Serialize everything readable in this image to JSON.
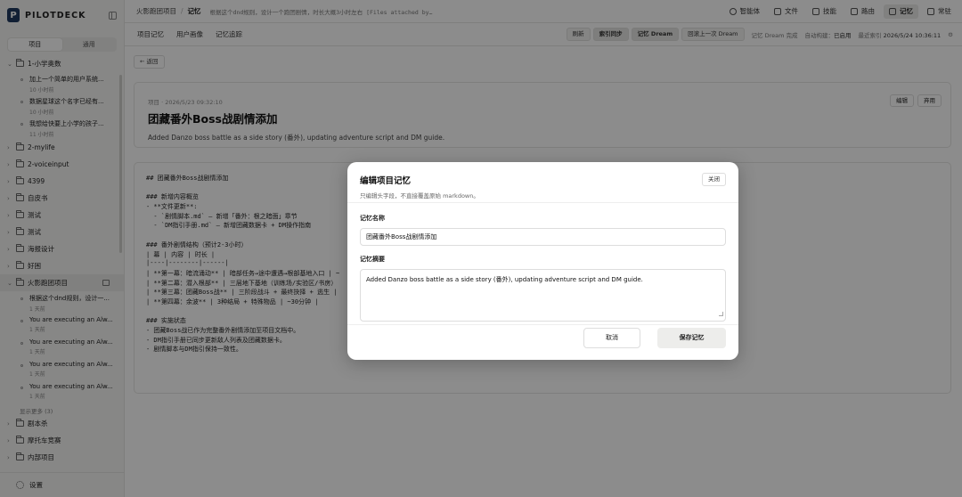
{
  "app": {
    "logo_letter": "P",
    "name": "PILOTDECK"
  },
  "sidebar": {
    "seg_project": "项目",
    "seg_general": "通用",
    "groups": [
      {
        "name": "1-小学奥数",
        "expanded": true,
        "items": [
          {
            "title": "加上一个简单的用户系统...",
            "time": "10 小时前"
          },
          {
            "title": "数据星球这个名字已经有...",
            "time": "10 小时前"
          },
          {
            "title": "我想给快要上小学的孩子...",
            "time": "11 小时前"
          }
        ]
      },
      {
        "name": "2-mylife"
      },
      {
        "name": "2-voiceinput"
      },
      {
        "name": "4399"
      },
      {
        "name": "自皮书"
      },
      {
        "name": "测试"
      },
      {
        "name": "测试"
      },
      {
        "name": "海报设计"
      },
      {
        "name": "好困"
      },
      {
        "name": "火影跑团项目",
        "expanded": true,
        "active": true,
        "items": [
          {
            "title": "根据这个dnd规则，设计一...",
            "time": "1 天前"
          },
          {
            "title": "You are executing an Alw...",
            "time": "1 天前"
          },
          {
            "title": "You are executing an Alw...",
            "time": "1 天前"
          },
          {
            "title": "You are executing an Alw...",
            "time": "1 天前"
          },
          {
            "title": "You are executing an Alw...",
            "time": "1 天前"
          }
        ],
        "more": "显示更多 (3)"
      },
      {
        "name": "剧本杀"
      },
      {
        "name": "摩托车竞赛"
      },
      {
        "name": "内部项目"
      }
    ],
    "settings": "设置"
  },
  "topbar": {
    "crumb_project": "火影跑团项目",
    "crumb_page": "记忆",
    "session": "根据这个dnd规则，设计一个跑团剧情，时长大概3小时左右 [Files attached by u…",
    "nav": [
      {
        "label": "智能体",
        "icon": "agent-icon"
      },
      {
        "label": "文件",
        "icon": "folder-icon"
      },
      {
        "label": "技能",
        "icon": "skill-icon"
      },
      {
        "label": "路由",
        "icon": "route-icon"
      },
      {
        "label": "记忆",
        "icon": "memory-icon",
        "active": true
      },
      {
        "label": "常驻",
        "icon": "resident-icon"
      }
    ]
  },
  "subbar": {
    "tabs": [
      "项目记忆",
      "用户画像",
      "记忆追踪"
    ],
    "refresh": "刷新",
    "index_sync": "索引同步",
    "dream": "记忆 Dream",
    "rollback": "回滚上一次 Dream",
    "dream_status": "记忆 Dream 完成",
    "auto_build_label": "自动构建：",
    "auto_build_value": "已启用",
    "last_index_label": "最近索引",
    "last_index_value": "2026/5/24 10:36:11"
  },
  "back": "← 返回",
  "memory": {
    "date": "项目 · 2026/5/23 09:32:10",
    "title": "团藏番外Boss战剧情添加",
    "summary": "Added Danzo boss battle as a side story (番外), updating adventure script and DM guide.",
    "edit": "编辑",
    "delete": "弃用",
    "content_lines": [
      "## 团藏番外Boss战剧情添加",
      "",
      "### 新增内容概览",
      "- **文件更新**:",
      "  - `剧情脚本.md` — 新增「番外：根之暗面」章节",
      "  - `DM指引手册.md` — 新增团藏数据卡 + DM操作指南",
      "",
      "### 番外剧情结构（预计2-3小时）",
      "| 幕 | 内容 | 时长 |",
      "|----|--------|------|",
      "| **第一幕：暗流涌动** | 暗部任务→途中遭遇→根部基地入口 | ~",
      "| **第二幕：潜入根部** | 三层地下基地（训练场/实验区/书房）",
      "| **第三幕：团藏Boss战** | 三阶段战斗 + 最终抉择 + 逃生 |",
      "| **第四幕：余波** | 3种结局 + 特殊物品 | ~30分钟 |",
      "",
      "### 实施状态",
      "- 团藏Boss战已作为完整番外剧情添加至项目文档中。",
      "- DM指引手册已同步更新敌人列表及团藏数据卡。",
      "- 剧情脚本与DM指引保持一致性。"
    ]
  },
  "modal": {
    "title": "编辑项目记忆",
    "subtitle": "只编辑头字段，不直接覆盖原始 markdown。",
    "close": "关闭",
    "name_label": "记忆名称",
    "name_value": "团藏番外Boss战剧情添加",
    "summary_label": "记忆摘要",
    "summary_value": "Added Danzo boss battle as a side story (番外), updating adventure script and DM guide.",
    "cancel": "取消",
    "save": "保存记忆"
  }
}
